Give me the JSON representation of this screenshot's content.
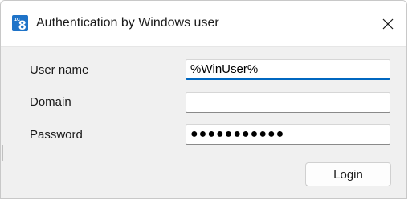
{
  "window": {
    "title": "Authentication by Windows user",
    "app_icon": "1c-8-icon",
    "app_icon_text": "8",
    "app_icon_small_text": "1С",
    "close_icon": "close-icon",
    "accent_color": "#1e73c8"
  },
  "form": {
    "user_name": {
      "label": "User name",
      "value": "%WinUser%"
    },
    "domain": {
      "label": "Domain",
      "value": ""
    },
    "password": {
      "label": "Password",
      "value": "●●●●●●●●●●●"
    }
  },
  "actions": {
    "login_label": "Login"
  }
}
